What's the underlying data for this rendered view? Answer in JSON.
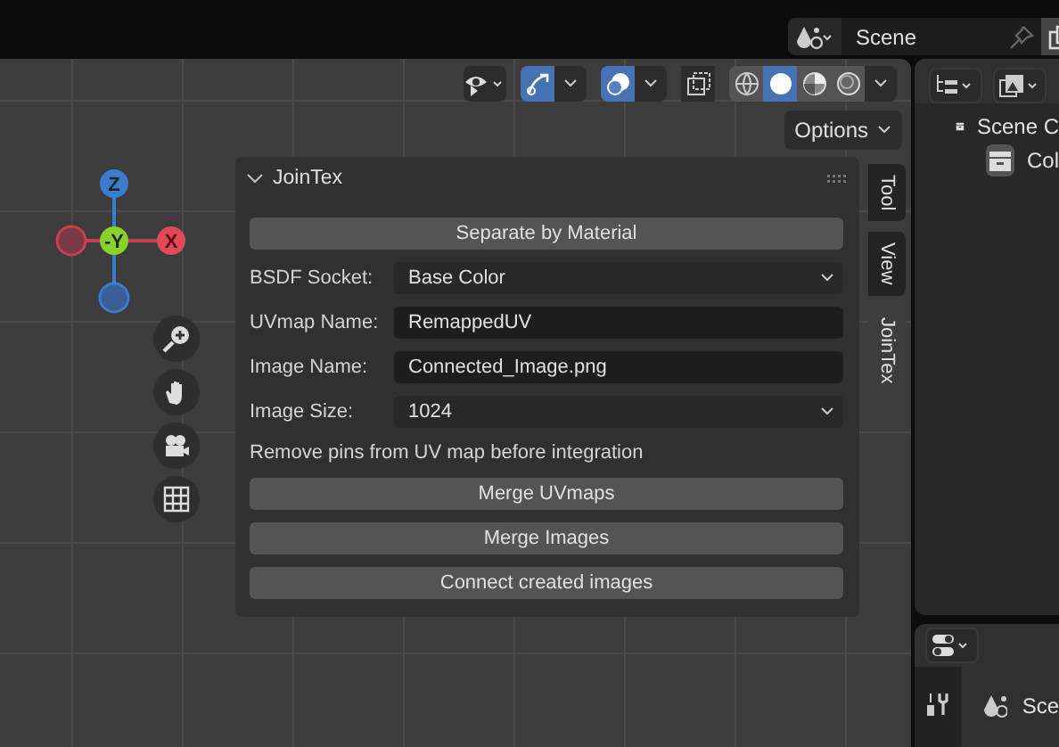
{
  "topbar": {
    "scene_field": {
      "value": "Scene"
    }
  },
  "viewport_header": {
    "gizmo_toggle_on": true,
    "overlays_on": true,
    "xray_on": false,
    "shading_modes": [
      {
        "kind": "wireframe",
        "selected": false
      },
      {
        "kind": "solid",
        "selected": true
      },
      {
        "kind": "material",
        "selected": false
      },
      {
        "kind": "rendered",
        "selected": false
      }
    ]
  },
  "options_button": "Options",
  "gizmo": {
    "axes": [
      {
        "kind": "z",
        "label": "Z"
      },
      {
        "kind": "y",
        "label": "-Y"
      },
      {
        "kind": "x",
        "label": "X"
      }
    ]
  },
  "sidebar_tabs": [
    {
      "label": "Tool",
      "selected": false
    },
    {
      "label": "View",
      "selected": false
    },
    {
      "label": "JoinTex",
      "selected": true
    }
  ],
  "panel": {
    "title": "JoinTex",
    "expanded": true,
    "rows": [
      {
        "kind": "button",
        "text": "Separate by Material"
      },
      {
        "kind": "dropdown",
        "label": "BSDF Socket:",
        "value": "Base Color"
      },
      {
        "kind": "text_field",
        "label": "UVmap Name:",
        "value": "RemappedUV"
      },
      {
        "kind": "text_field",
        "label": "Image Name:",
        "value": "Connected_Image.png"
      },
      {
        "kind": "dropdown",
        "label": "Image Size:",
        "value": "1024"
      },
      {
        "kind": "note",
        "text": "Remove pins from UV map before integration"
      },
      {
        "kind": "button",
        "text": "Merge UVmaps"
      },
      {
        "kind": "button",
        "text": "Merge Images"
      },
      {
        "kind": "button",
        "text": "Connect created images"
      }
    ]
  },
  "outliner": {
    "items": [
      {
        "label": "Scene C",
        "children": [
          {
            "label": "Col"
          }
        ]
      }
    ]
  },
  "properties": {
    "scene_label": "Sce"
  }
}
